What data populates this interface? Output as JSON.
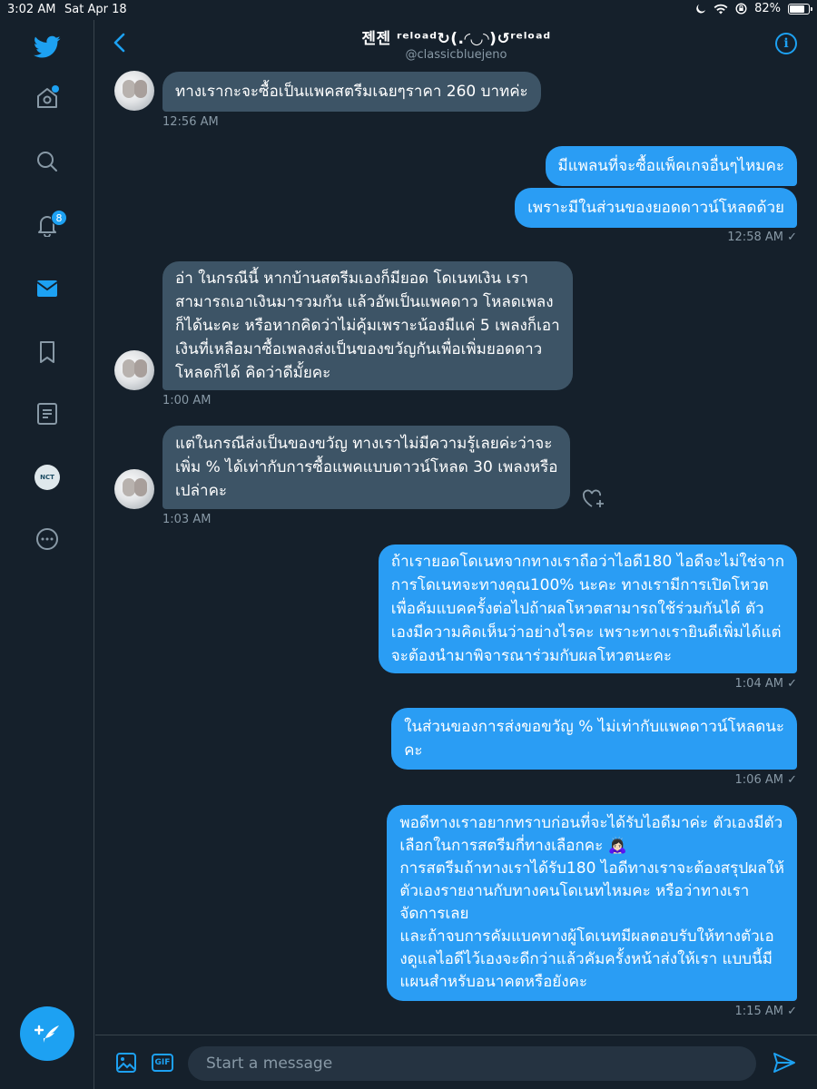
{
  "status_bar": {
    "time": "3:02 AM",
    "date": "Sat Apr 18",
    "battery": "82%",
    "battery_level": 0.82
  },
  "sidebar": {
    "items": [
      {
        "name": "home",
        "icon": "home-icon"
      },
      {
        "name": "explore",
        "icon": "search-icon"
      },
      {
        "name": "notifications",
        "icon": "bell-icon",
        "badge": "8"
      },
      {
        "name": "messages",
        "icon": "mail-icon"
      },
      {
        "name": "bookmarks",
        "icon": "bookmark-icon"
      },
      {
        "name": "lists",
        "icon": "list-icon"
      },
      {
        "name": "profile",
        "icon": "avatar",
        "label": "NCT"
      },
      {
        "name": "more",
        "icon": "more-icon"
      }
    ],
    "compose_icon": "compose-plus-feather-icon"
  },
  "header": {
    "title": "젠젠 ʳᵉˡᵒᵃᵈ↻(.◜◡◝)↺ʳᵉˡᵒᵃᵈ",
    "handle": "@classicbluejeno",
    "back_icon": "chevron-left-icon",
    "info_icon": "info-icon",
    "info_label": "i"
  },
  "messages": [
    {
      "dir": "in",
      "lines": [
        "ทางเรากะจะซื้อเป็นแพคสตรีมเฉยๆราคา 260 บาทค่ะ"
      ],
      "time": "12:56 AM"
    },
    {
      "dir": "out",
      "lines": [
        "มีแพลนที่จะซื้อแพ็คเกจอื่นๆไหมคะ"
      ],
      "time": ""
    },
    {
      "dir": "out",
      "lines": [
        "เพราะมีในส่วนของยอดดาวน์โหลดด้วย"
      ],
      "time": "12:58 AM ✓"
    },
    {
      "dir": "in",
      "lines": [
        "อ่า ในกรณีนี้ หากบ้านสตรีมเองก็มียอด โดเนทเงิน เรา",
        "สามารถเอาเงินมารวมกัน แล้วอัพเป็นแพคดาว โหลดเพลง",
        "ก็ได้นะคะ หรือหากคิดว่าไม่คุ้มเพราะน้องมีแค่ 5 เพลงก็เอา",
        "เงินที่เหลือมาซื้อเพลงส่งเป็นของขวัญกันเพื่อเพิ่มยอดดาว",
        "โหลดก็ได้ คิดว่าดีมั้ยคะ"
      ],
      "time": "1:00 AM"
    },
    {
      "dir": "in",
      "lines": [
        "แต่ในกรณีส่งเป็นของขวัญ ทางเราไม่มีความรู้เลยค่ะว่าจะ",
        "เพิ่ม % ได้เท่ากับการซื้อแพคแบบดาวน์โหลด 30 เพลงหรือ",
        "เปล่าคะ"
      ],
      "time": "1:03 AM"
    },
    {
      "dir": "out",
      "lines": [
        "ถ้าเรายอดโดเนทจากทางเราถือว่าไอดี180 ไอดีจะไม่ใช่จาก",
        "การโดเนทจะทางคุณ100% นะคะ ทางเรามีการเปิดโหวต",
        "เพื่อคัมแบคครั้งต่อไปถ้าผลโหวตสามารถใช้ร่วมกันได้ ตัว",
        "เองมีความคิดเห็นว่าอย่างไรคะ เพราะทางเรายินดีเพิ่มได้แต่",
        "จะต้องนำมาพิจารณาร่วมกับผลโหวตนะคะ"
      ],
      "time": "1:04 AM ✓"
    },
    {
      "dir": "out",
      "lines": [
        "ในส่วนของการส่งขอขวัญ % ไม่เท่ากับแพคดาวน์โหลดนะ",
        "คะ"
      ],
      "time": "1:06 AM ✓"
    },
    {
      "dir": "out",
      "lines": [
        "พอดีทางเราอยากทราบก่อนที่จะได้รับไอดีมาค่ะ ตัวเองมีตัว",
        "เลือกในการสตรีมกี่ทางเลือกคะ 🙇🏻‍♀️",
        "การสตรีมถ้าทางเราได้รับ180 ไอดีทางเราจะต้องสรุปผลให้",
        "ตัวเองรายงานกับทางคนโดเนทไหมคะ หรือว่าทางเรา",
        "จัดการเลย",
        "และถ้าจบการคัมแบคทางผู้โดเนทมีผลตอบรับให้ทางตัวเอ",
        "งดูแลไอดีไว้เองจะดีกว่าแล้วคัมครั้งหน้าส่งให้เรา แบบนี้มี",
        "แผนสำหรับอนาคตหรือยังคะ"
      ],
      "time": "1:15 AM ✓"
    }
  ],
  "composer": {
    "placeholder": "Start a message",
    "image_icon": "image-icon",
    "gif_label": "GIF",
    "send_icon": "send-icon"
  },
  "colors": {
    "background": "#15202b",
    "accent": "#1da1f2",
    "incoming_bubble": "#3d5466",
    "outgoing_bubble": "#2a9df4",
    "muted_text": "#8899a6"
  }
}
